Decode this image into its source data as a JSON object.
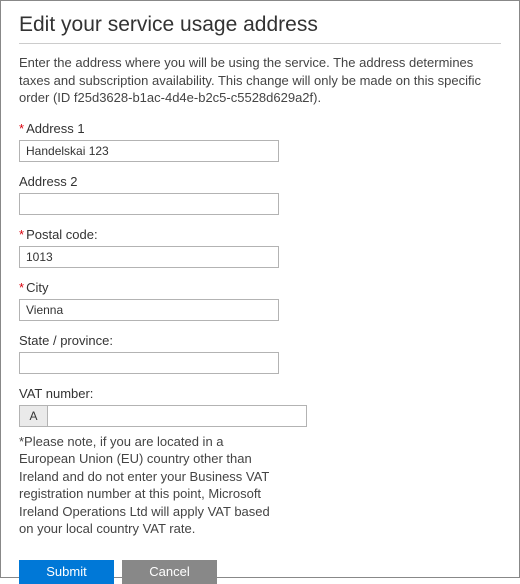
{
  "title": "Edit your service usage address",
  "intro": "Enter the address where you will be using the service. The address determines taxes and subscription availability. This change will only be made on this specific order (ID f25d3628-b1ac-4d4e-b2c5-c5528d629a2f).",
  "fields": {
    "address1": {
      "label": "Address 1",
      "value": "Handelskai 123",
      "required": true
    },
    "address2": {
      "label": "Address 2",
      "value": "",
      "required": false
    },
    "postal": {
      "label": "Postal code:",
      "value": "1013",
      "required": true
    },
    "city": {
      "label": "City",
      "value": "Vienna",
      "required": true
    },
    "state": {
      "label": "State / province:",
      "value": "",
      "required": false
    },
    "vat": {
      "label": "VAT number:",
      "prefix": "A",
      "value": "",
      "required": false
    }
  },
  "required_mark": "*",
  "vat_note": "*Please note, if you are located in a European Union (EU) country other than Ireland and do not enter your Business VAT registration number at this point, Microsoft Ireland Operations Ltd will apply VAT based on your local country VAT rate.",
  "buttons": {
    "submit": "Submit",
    "cancel": "Cancel"
  }
}
